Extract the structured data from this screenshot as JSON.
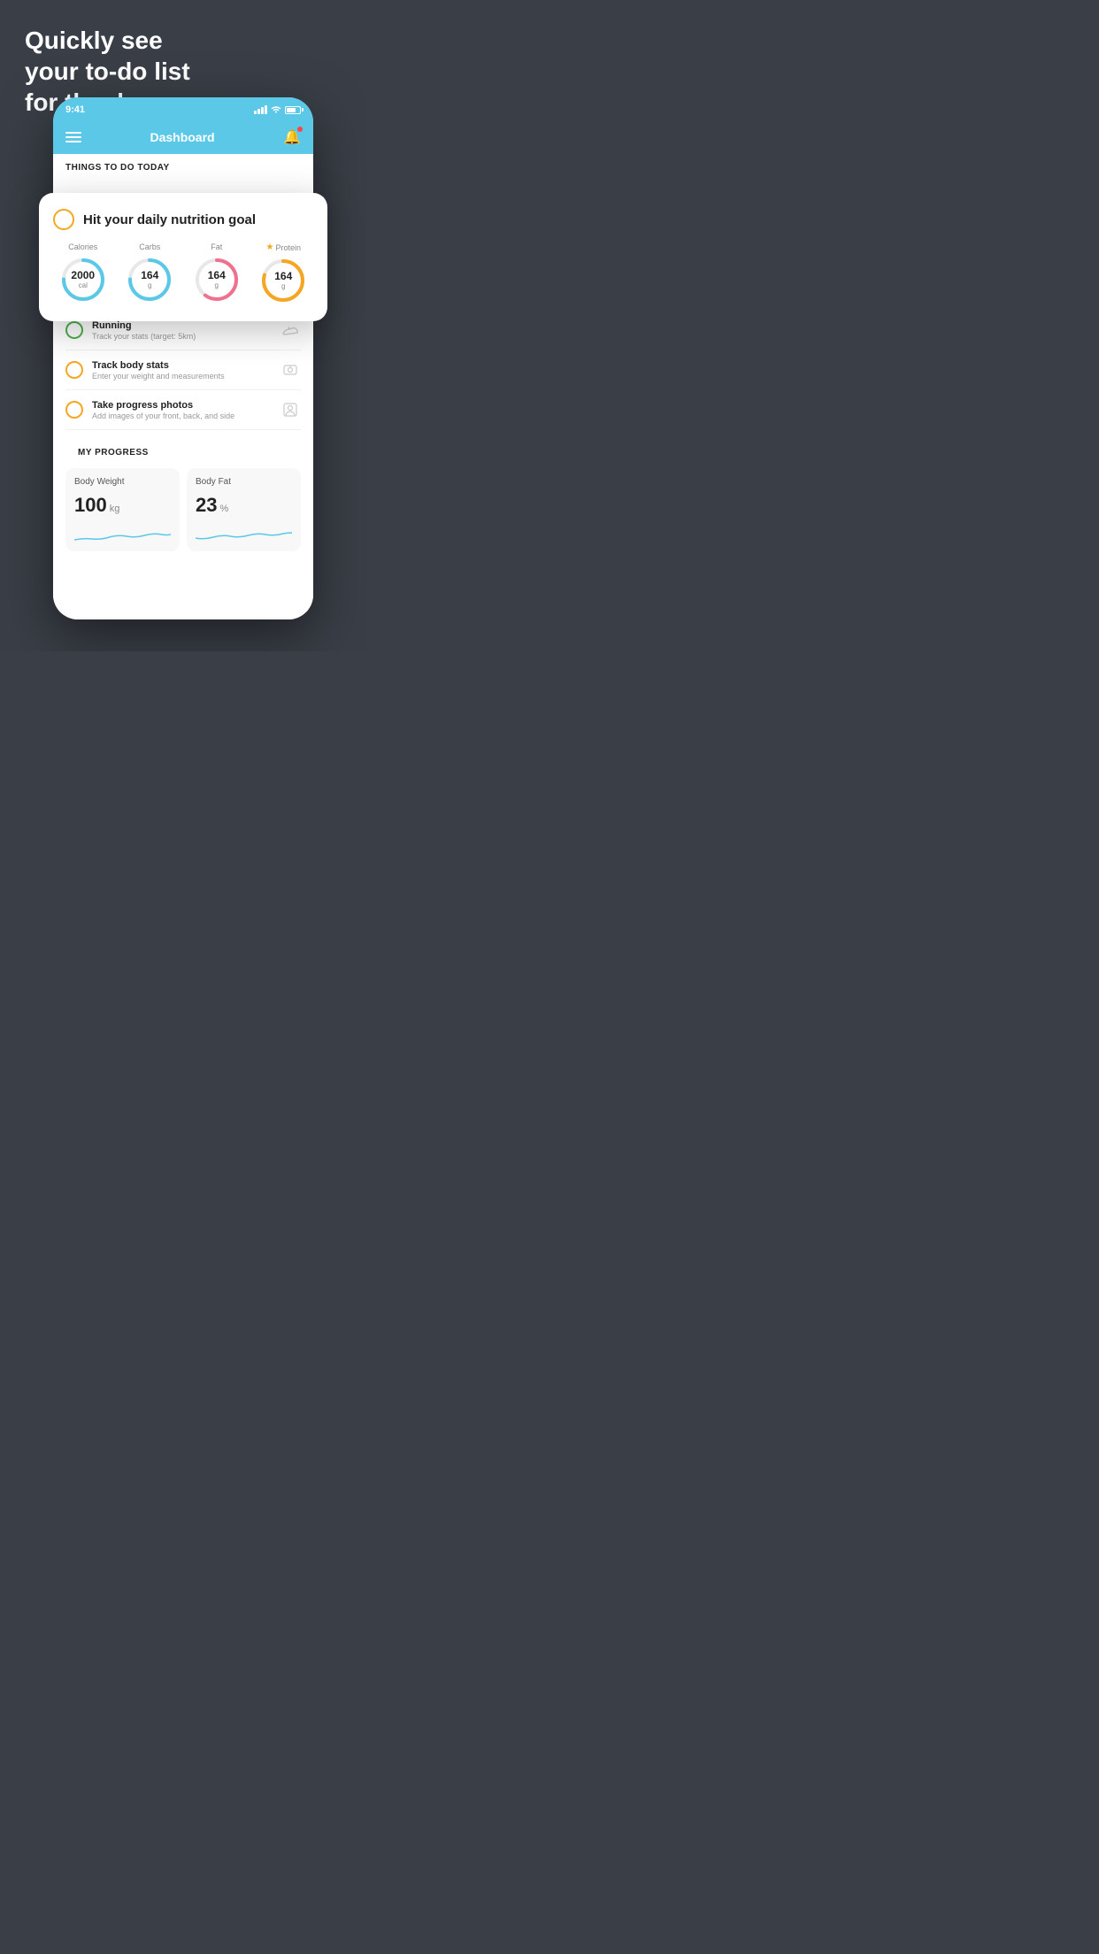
{
  "background": {
    "color": "#3a3f47"
  },
  "hero": {
    "line1": "Quickly see",
    "line2": "your to-do list",
    "line3": "for the day."
  },
  "status_bar": {
    "time": "9:41",
    "color": "#5bc8e8"
  },
  "nav": {
    "title": "Dashboard",
    "color": "#5bc8e8"
  },
  "phone": {
    "things_header": "THINGS TO DO TODAY"
  },
  "floating_card": {
    "title": "Hit your daily nutrition goal",
    "items": [
      {
        "label": "Calories",
        "value": "2000",
        "unit": "cal",
        "color_ring": "blue",
        "starred": false
      },
      {
        "label": "Carbs",
        "value": "164",
        "unit": "g",
        "color_ring": "blue",
        "starred": false
      },
      {
        "label": "Fat",
        "value": "164",
        "unit": "g",
        "color_ring": "pink",
        "starred": false
      },
      {
        "label": "Protein",
        "value": "164",
        "unit": "g",
        "color_ring": "yellow",
        "starred": true
      }
    ]
  },
  "todo_items": [
    {
      "title": "Running",
      "subtitle": "Track your stats (target: 5km)",
      "circle_color": "green",
      "icon": "shoe"
    },
    {
      "title": "Track body stats",
      "subtitle": "Enter your weight and measurements",
      "circle_color": "yellow",
      "icon": "scale"
    },
    {
      "title": "Take progress photos",
      "subtitle": "Add images of your front, back, and side",
      "circle_color": "yellow",
      "icon": "portrait"
    }
  ],
  "progress": {
    "header": "MY PROGRESS",
    "cards": [
      {
        "title": "Body Weight",
        "value": "100",
        "unit": "kg"
      },
      {
        "title": "Body Fat",
        "value": "23",
        "unit": "%"
      }
    ]
  }
}
